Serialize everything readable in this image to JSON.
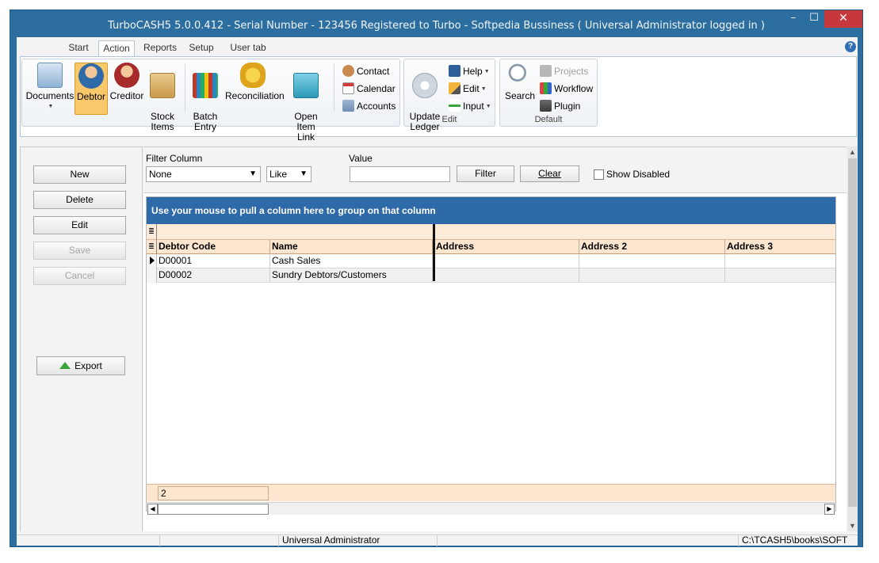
{
  "window": {
    "title": "TurboCASH5 5.0.0.412  - Serial Number - 123456 Registered to Turbo - Softpedia Bussiness ( Universal Administrator logged in )",
    "minimize": "–",
    "maximize": "☐",
    "close": "✕"
  },
  "tabs": [
    "Start",
    "Action",
    "Reports",
    "Setup",
    "User tab"
  ],
  "active_tab": "Action",
  "help_label": "?",
  "ribbon": {
    "main_buttons": [
      {
        "label": "Documents",
        "icon": "documents-icon",
        "dropdown": true
      },
      {
        "label": "Debtor",
        "icon": "debtor-icon",
        "active": true
      },
      {
        "label": "Creditor",
        "icon": "creditor-icon"
      },
      {
        "label": "Stock\nItems",
        "icon": "stock-items-icon"
      },
      {
        "label": "Batch\nEntry",
        "icon": "batch-entry-icon"
      },
      {
        "label": "Reconciliation",
        "icon": "reconciliation-icon"
      },
      {
        "label": "Open Item\nLink",
        "icon": "open-item-link-icon"
      }
    ],
    "small_buttons_1": [
      {
        "label": "Contact",
        "icon": "contact-icon"
      },
      {
        "label": "Calendar",
        "icon": "calendar-icon"
      },
      {
        "label": "Accounts",
        "icon": "accounts-icon"
      }
    ],
    "edit_group": {
      "label": "Edit",
      "update_ledger": "Update\nLedger",
      "items": [
        {
          "label": "Help",
          "icon": "help-book-icon",
          "dropdown": true
        },
        {
          "label": "Edit",
          "icon": "pencil-icon",
          "dropdown": true
        },
        {
          "label": "Input",
          "icon": "plus-icon",
          "dropdown": true
        }
      ]
    },
    "default_group": {
      "label": "Default",
      "search": "Search",
      "items": [
        {
          "label": "Projects",
          "icon": "projects-icon",
          "disabled": true
        },
        {
          "label": "Workflow",
          "icon": "workflow-icon"
        },
        {
          "label": "Plugin",
          "icon": "plugin-icon"
        }
      ]
    }
  },
  "left_buttons": {
    "new": "New",
    "delete": "Delete",
    "edit": "Edit",
    "save": "Save",
    "cancel": "Cancel",
    "export": "Export"
  },
  "filter": {
    "column_label": "Filter Column",
    "column_value": "None",
    "operator_value": "Like",
    "value_label": "Value",
    "value_text": "",
    "filter_button": "Filter",
    "clear_button": "Clear",
    "show_disabled": "Show Disabled"
  },
  "grid": {
    "group_hint": "Use your mouse to pull a column here to group on that column",
    "columns": [
      "Debtor Code",
      "Name",
      "Address",
      "Address 2",
      "Address 3"
    ],
    "rows": [
      [
        "D00001",
        "Cash Sales",
        "",
        "",
        ""
      ],
      [
        "D00002",
        "Sundry Debtors/Customers",
        "",
        "",
        ""
      ]
    ],
    "record_count": "2"
  },
  "status": {
    "user": "Universal Administrator",
    "path": "C:\\TCASH5\\books\\SOFT"
  },
  "colors": {
    "title_bar": "#2c6e9f",
    "group_bar": "#2f6aa8",
    "header_bg": "#fde6cf",
    "active_button": "#f9c86b"
  }
}
